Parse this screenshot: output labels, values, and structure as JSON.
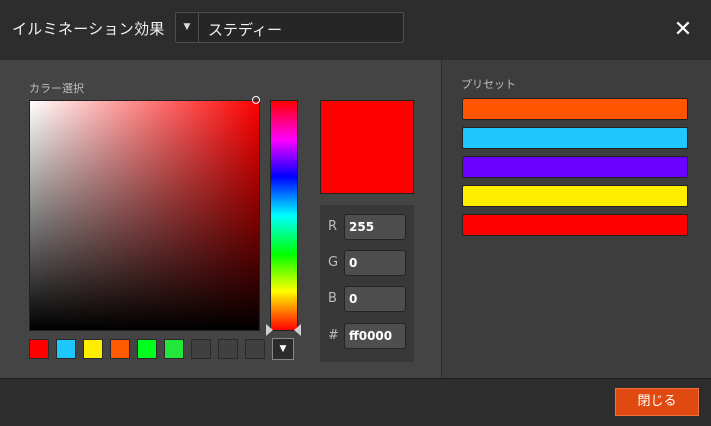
{
  "header": {
    "title": "イルミネーション効果",
    "effect_dropdown": {
      "selected": "ステディー",
      "arrow_icon": "▼"
    },
    "close_icon": "✕"
  },
  "color_picker": {
    "label": "カラー選択",
    "current_color": "#ff0000",
    "swatches": [
      {
        "color": "#ff0000"
      },
      {
        "color": "#1ec8ff"
      },
      {
        "color": "#ffee00"
      },
      {
        "color": "#ff5a00"
      },
      {
        "color": "#00ff1e"
      },
      {
        "color": "#22e63a"
      },
      {
        "color": "#404040"
      },
      {
        "color": "#404040"
      },
      {
        "color": "#404040"
      }
    ],
    "more_icon": "▼",
    "rgb": {
      "r_label": "R",
      "r_value": "255",
      "g_label": "G",
      "g_value": "0",
      "b_label": "B",
      "b_value": "0",
      "hex_label": "#",
      "hex_value": "ff0000"
    }
  },
  "presets": {
    "label": "プリセット",
    "items": [
      {
        "color": "#ff5500"
      },
      {
        "color": "#1ec8ff"
      },
      {
        "color": "#6a00ff"
      },
      {
        "color": "#ffee00"
      },
      {
        "color": "#ff0000"
      }
    ]
  },
  "footer": {
    "close_button_label": "閉じる"
  }
}
